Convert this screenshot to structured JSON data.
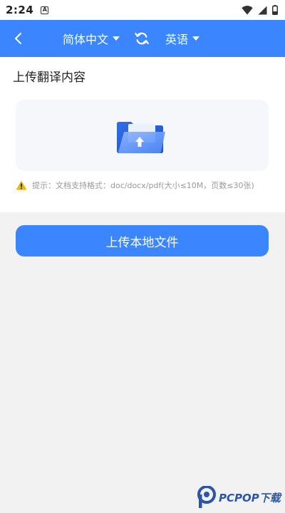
{
  "status_bar": {
    "time": "2:24",
    "notification_glyph": "A",
    "icons": [
      "wifi-icon",
      "signal-icon",
      "battery-icon"
    ]
  },
  "app_bar": {
    "back_icon": "chevron-left-icon",
    "source_language": "简体中文",
    "swap_icon": "swap-icon",
    "target_language": "英语"
  },
  "upload": {
    "section_title": "上传翻译内容",
    "drop_zone_icon": "folder-upload-icon",
    "hint": "提示：文档支持格式：doc/docx/pdf(大小≤10M，页数≤30张)",
    "button_label": "上传本地文件"
  },
  "watermark": {
    "text": "PCPOP下载"
  },
  "colors": {
    "primary": "#3b86ff",
    "background": "#f2f2f2",
    "surface": "#ffffff",
    "drop_zone": "#f5f7fb",
    "hint_text": "#999999",
    "warning": "#f5b400"
  }
}
